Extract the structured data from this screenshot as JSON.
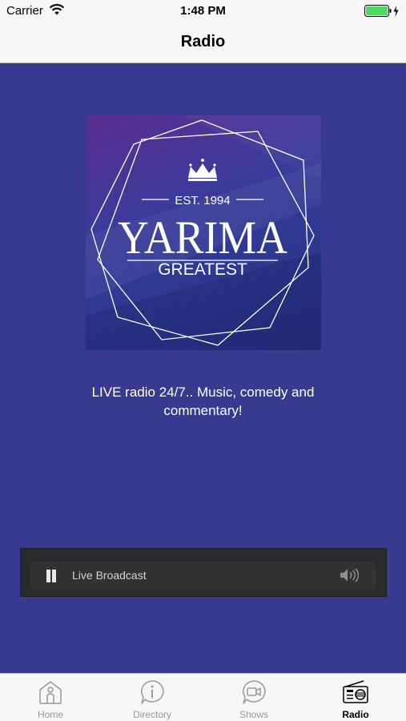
{
  "status_bar": {
    "carrier": "Carrier",
    "time": "1:48 PM",
    "wifi_icon": "wifi-icon",
    "battery_icon": "battery-icon"
  },
  "nav": {
    "title": "Radio"
  },
  "logo": {
    "est": "EST. 1994",
    "name": "YARIMA",
    "subtitle": "GREATEST",
    "crown_icon": "crown-icon"
  },
  "tagline": "LIVE radio 24/7.. Music, comedy and commentary!",
  "player": {
    "label": "Live Broadcast",
    "state": "playing",
    "pause_icon": "pause-icon",
    "volume_icon": "volume-icon"
  },
  "tabs": [
    {
      "label": "Home",
      "icon": "home-icon",
      "active": false
    },
    {
      "label": "Directory",
      "icon": "info-icon",
      "active": false
    },
    {
      "label": "Shows",
      "icon": "video-chat-icon",
      "active": false
    },
    {
      "label": "Radio",
      "icon": "radio-icon",
      "active": true
    }
  ],
  "colors": {
    "background": "#383a8f",
    "bar": "#f7f7f7",
    "player": "#2a2a2c",
    "battery": "#4cd964"
  }
}
